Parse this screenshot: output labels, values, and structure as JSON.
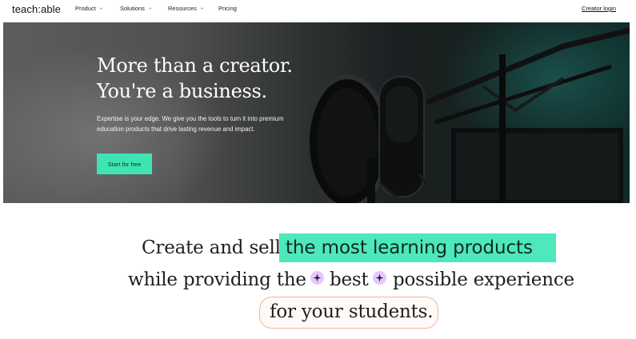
{
  "nav": {
    "logo": "teach:able",
    "items": [
      {
        "label": "Product",
        "has_dropdown": true
      },
      {
        "label": "Solutions",
        "has_dropdown": true
      },
      {
        "label": "Resources",
        "has_dropdown": true
      },
      {
        "label": "Pricing",
        "has_dropdown": false
      }
    ],
    "login_label": "Creator login"
  },
  "hero": {
    "title_line1": "More than a creator.",
    "title_line2": "You're a business.",
    "subtitle": "Expertise is your edge. We give you the tools to turn it into premium education products that drive lasting revenue and impact.",
    "cta_label": "Start for free",
    "cta_color": "#3ee5b2"
  },
  "headline": {
    "line1_prefix": "Create and sell",
    "line1_highlight": "the most learning products",
    "line2_prefix": "while providing the",
    "line2_middle": "best",
    "line2_suffix": "possible experience",
    "line3": "for your students.",
    "highlight_color": "#4de8bb",
    "outline_color": "#f0b59d",
    "sparkle_color": "#e6c6ff",
    "sparkle_icon": "sparkle-icon"
  }
}
